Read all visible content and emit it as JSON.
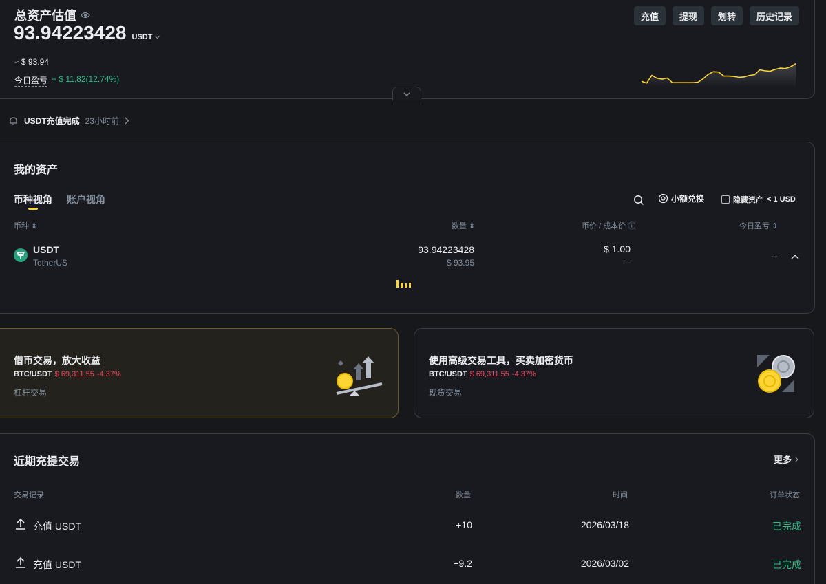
{
  "overview": {
    "title": "总资产估值",
    "balance": "93.94223428",
    "currency": "USDT",
    "approx": "≈ $ 93.94",
    "pnl_label": "今日盈亏",
    "pnl_value": "+ $ 11.82(12.74%)",
    "buttons": [
      "充值",
      "提现",
      "划转",
      "历史记录"
    ],
    "sparkline": [
      0.18,
      0.1,
      0.45,
      0.32,
      0.28,
      0.33,
      0.12,
      0.12,
      0.12,
      0.12,
      0.12,
      0.14,
      0.3,
      0.5,
      0.62,
      0.6,
      0.42,
      0.42,
      0.4,
      0.36,
      0.38,
      0.45,
      0.48,
      0.7,
      0.66,
      0.64,
      0.72,
      0.78,
      0.76,
      0.84,
      0.98
    ]
  },
  "notice": {
    "text": "USDT充值完成",
    "time": "23小时前"
  },
  "assets": {
    "title": "我的资产",
    "tabs": [
      "币种视角",
      "账户视角"
    ],
    "convert_label": "小额兑换",
    "hide_label": "隐藏资产",
    "hide_threshold": "< 1 USD",
    "columns": [
      "币种",
      "数量",
      "币价 / 成本价",
      "今日盈亏"
    ],
    "rows": [
      {
        "symbol": "USDT",
        "name": "TetherUS",
        "amount": "93.94223428",
        "amount_usd": "$ 93.95",
        "price": "$ 1.00",
        "cost": "--",
        "pnl": "--"
      }
    ]
  },
  "promos": [
    {
      "title": "借币交易，放大收益",
      "pair": "BTC/USDT",
      "price": "$ 69,311.55",
      "change": "-4.37%",
      "sub": "杠杆交易"
    },
    {
      "title": "使用高级交易工具，买卖加密货币",
      "pair": "BTC/USDT",
      "price": "$ 69,311.55",
      "change": "-4.37%",
      "sub": "现货交易"
    }
  ],
  "recent": {
    "title": "近期充提交易",
    "more": "更多",
    "columns": [
      "交易记录",
      "数量",
      "时间",
      "订单状态"
    ],
    "rows": [
      {
        "label": "充值 USDT",
        "amount": "+10",
        "time": "2026/03/18",
        "status": "已完成"
      },
      {
        "label": "充值 USDT",
        "amount": "+9.2",
        "time": "2026/03/02",
        "status": "已完成"
      }
    ]
  },
  "colors": {
    "accent": "#fcd535",
    "up": "#2ebd85",
    "down": "#f6465d"
  }
}
